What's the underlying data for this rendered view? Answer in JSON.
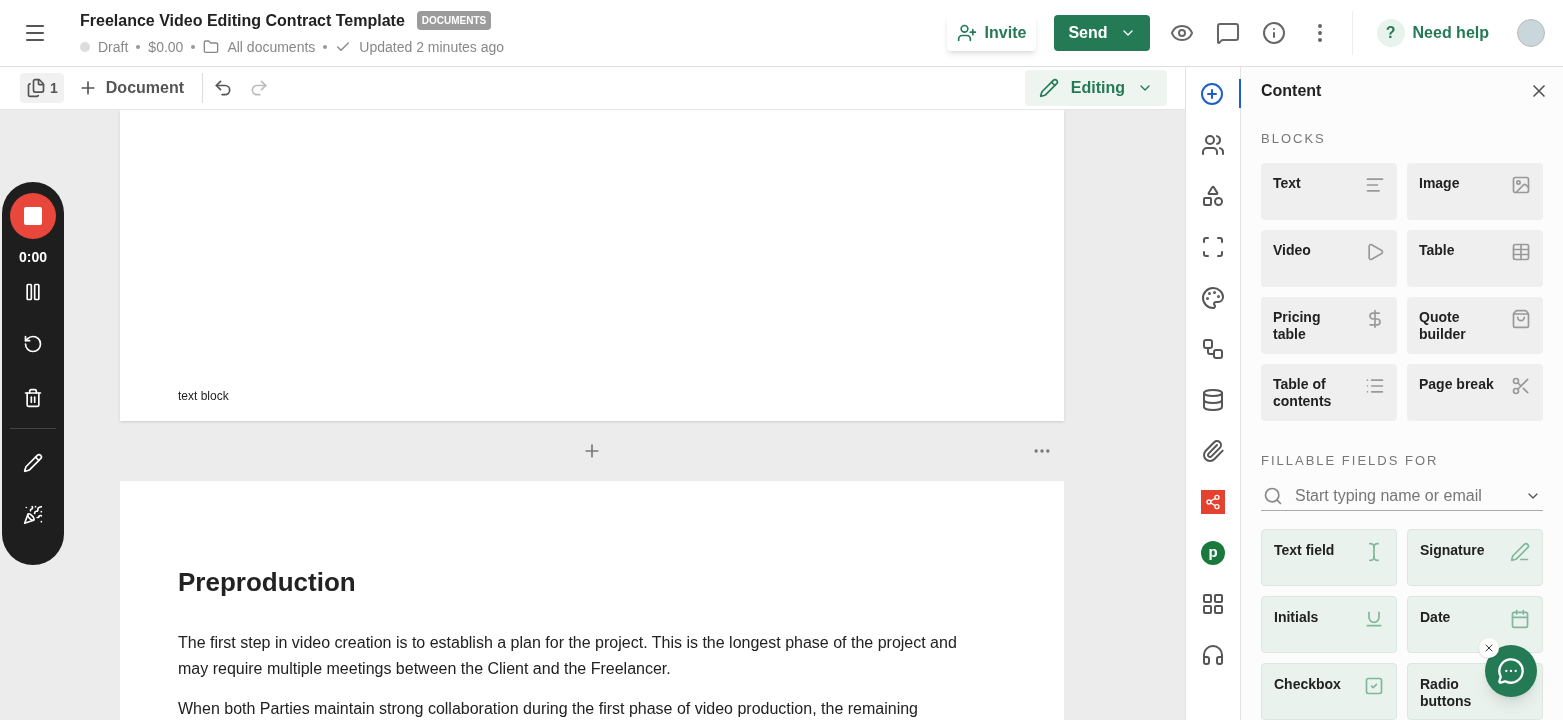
{
  "header": {
    "title": "Freelance Video Editing Contract Template",
    "badge": "DOCUMENTS",
    "status": "Draft",
    "price": "$0.00",
    "folder": "All documents",
    "updated": "Updated 2 minutes ago",
    "invite": "Invite",
    "send": "Send",
    "help_icon": "?",
    "help": "Need help"
  },
  "toolbar": {
    "page_count": "1",
    "add_document": "Document",
    "mode": "Editing"
  },
  "recorder": {
    "time": "0:00"
  },
  "page_1": {
    "caption": "text block"
  },
  "page_2": {
    "heading": "Preproduction",
    "paragraphs": [
      "The first step in video creation is to establish a plan for the project. This is the longest phase of the project and may require multiple meetings between the Client and the Freelancer.",
      "When both Parties maintain strong collaboration during the first phase of video production, the remaining"
    ]
  },
  "rail": [
    {
      "selected": true
    },
    {
      "selected": false
    },
    {
      "selected": false
    },
    {
      "selected": false
    },
    {
      "selected": false
    },
    {
      "selected": false
    },
    {
      "selected": false
    },
    {
      "selected": false
    },
    {
      "selected": false
    },
    {
      "selected": false,
      "logo_text": "p"
    },
    {
      "selected": false
    },
    {
      "selected": false
    }
  ],
  "content_panel": {
    "title": "Content",
    "blocks_heading": "BLOCKS",
    "blocks": [
      {
        "label": "Text"
      },
      {
        "label": "Image"
      },
      {
        "label": "Video"
      },
      {
        "label": "Table"
      },
      {
        "label": "Pricing table"
      },
      {
        "label": "Quote builder"
      },
      {
        "label": "Table of contents"
      },
      {
        "label": "Page break"
      }
    ],
    "fields_heading": "FILLABLE FIELDS FOR",
    "recipient_placeholder": "Start typing name or email",
    "fields": [
      {
        "label": "Text field"
      },
      {
        "label": "Signature"
      },
      {
        "label": "Initials"
      },
      {
        "label": "Date"
      },
      {
        "label": "Checkbox"
      },
      {
        "label": "Radio buttons"
      }
    ]
  }
}
